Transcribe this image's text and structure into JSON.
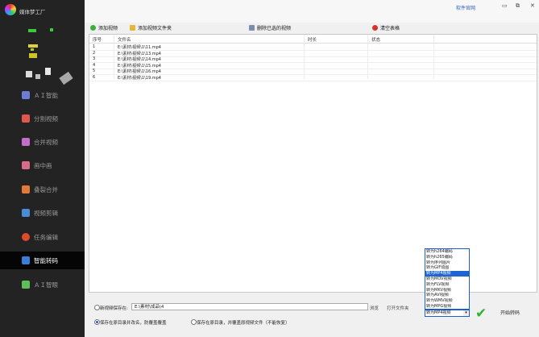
{
  "app": {
    "title": "媒体梦工厂"
  },
  "topbar": {
    "link": "软件官网",
    "min": "▭",
    "max": "⧉",
    "close": "✕"
  },
  "sidebar": {
    "items": [
      {
        "label": "ＡＩ智能",
        "icon": "robot-icon",
        "color": "#6b7fd8"
      },
      {
        "label": "分割视频",
        "icon": "split-icon",
        "color": "#e0574c"
      },
      {
        "label": "合并视频",
        "icon": "merge-icon",
        "color": "#c070c8"
      },
      {
        "label": "画中画",
        "icon": "pip-icon",
        "color": "#d66b8a"
      },
      {
        "label": "叠裂合并",
        "icon": "stack-icon",
        "color": "#e07a3a"
      },
      {
        "label": "视频剪辑",
        "icon": "edit-icon",
        "color": "#4a8cd8"
      },
      {
        "label": "任务编辑",
        "icon": "task-icon",
        "color": "#e04a2a"
      },
      {
        "label": "智能转码",
        "icon": "transcode-icon",
        "color": "#3a7dd8"
      },
      {
        "label": "ＡＩ智眼",
        "icon": "eye-icon",
        "color": "#5bbf5a"
      }
    ]
  },
  "toolbar": {
    "add_video": "添加视频",
    "add_folder": "添加视频文件夹",
    "delete_selected": "删除已选的视频",
    "clear_list": "清空表格"
  },
  "table": {
    "headers": [
      "序号",
      "文件名",
      "时长",
      "状态"
    ],
    "rows": [
      {
        "index": "1",
        "file": "E:\\素材\\视频\\1\\11.mp4"
      },
      {
        "index": "2",
        "file": "E:\\素材\\视频\\1\\13.mp4"
      },
      {
        "index": "3",
        "file": "E:\\素材\\视频\\1\\14.mp4"
      },
      {
        "index": "4",
        "file": "E:\\素材\\视频\\1\\15.mp4"
      },
      {
        "index": "5",
        "file": "E:\\素材\\视频\\1\\16.mp4"
      },
      {
        "index": "6",
        "file": "E:\\素材\\视频\\1\\19.mp4"
      }
    ]
  },
  "output": {
    "save_to_label": "新视频保存在:",
    "save_path": "E:\\素材\\成品\\4",
    "browse": "浏览",
    "open_folder": "打开文件夹",
    "option_rename": "保存在原目录并改名，防覆盖覆盖",
    "option_replace": "保存在原目录，并覆盖原视频文件（不能恢复）"
  },
  "format_options": [
    "转为h264编码",
    "转为h265编码",
    "转为序列图片",
    "转为GIF动图",
    "转为MP4视频",
    "转为MOV视频",
    "转为FLV视频",
    "转为MKV视频",
    "转为AVI视频",
    "转为WMV视频",
    "转为MPG视频"
  ],
  "format_selected": "转为MP4视频",
  "start_label": "开始转码"
}
